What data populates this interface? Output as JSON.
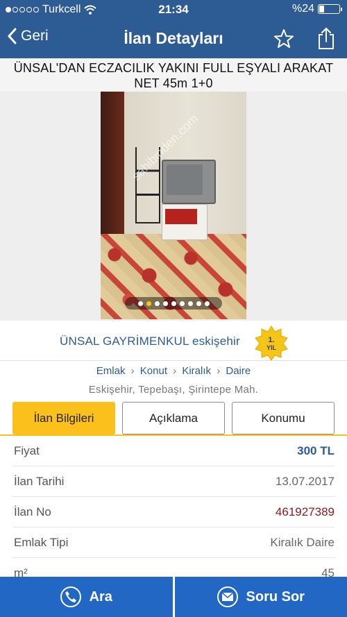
{
  "status": {
    "carrier": "Turkcell",
    "time": "21:34",
    "battery": "%24",
    "battery_level": 0.24
  },
  "nav": {
    "back": "Geri",
    "title": "İlan Detayları"
  },
  "listing": {
    "title": "ÜNSAL'DAN ECZACILIK YAKINI FULL EŞYALI ARAKAT NET 45m 1+0",
    "watermark": "sahibinden.com",
    "gallery_pages": 9,
    "gallery_active_index": 1
  },
  "seller": {
    "name": "ÜNSAL GAYRİMENKUL eskişehir",
    "badge_line1": "1.",
    "badge_line2": "YIL"
  },
  "breadcrumb": [
    "Emlak",
    "Konut",
    "Kiralık",
    "Daire"
  ],
  "location": "Eskişehir, Tepebaşı, Şirintepe Mah.",
  "tabs": [
    "İlan Bilgileri",
    "Açıklama",
    "Konumu"
  ],
  "details": [
    {
      "key": "Fiyat",
      "value": "300 TL"
    },
    {
      "key": "İlan Tarihi",
      "value": "13.07.2017"
    },
    {
      "key": "İlan No",
      "value": "461927389"
    },
    {
      "key": "Emlak Tipi",
      "value": "Kiralık Daire"
    },
    {
      "key": "m²",
      "value": "45"
    }
  ],
  "actions": {
    "call": "Ara",
    "ask": "Soru Sor"
  },
  "colors": {
    "header": "#2d5b93",
    "tab_active": "#fbc01b",
    "bottom_bar": "#2267c3",
    "price": "#2d5b93",
    "listing_no": "#8b1a1a"
  }
}
